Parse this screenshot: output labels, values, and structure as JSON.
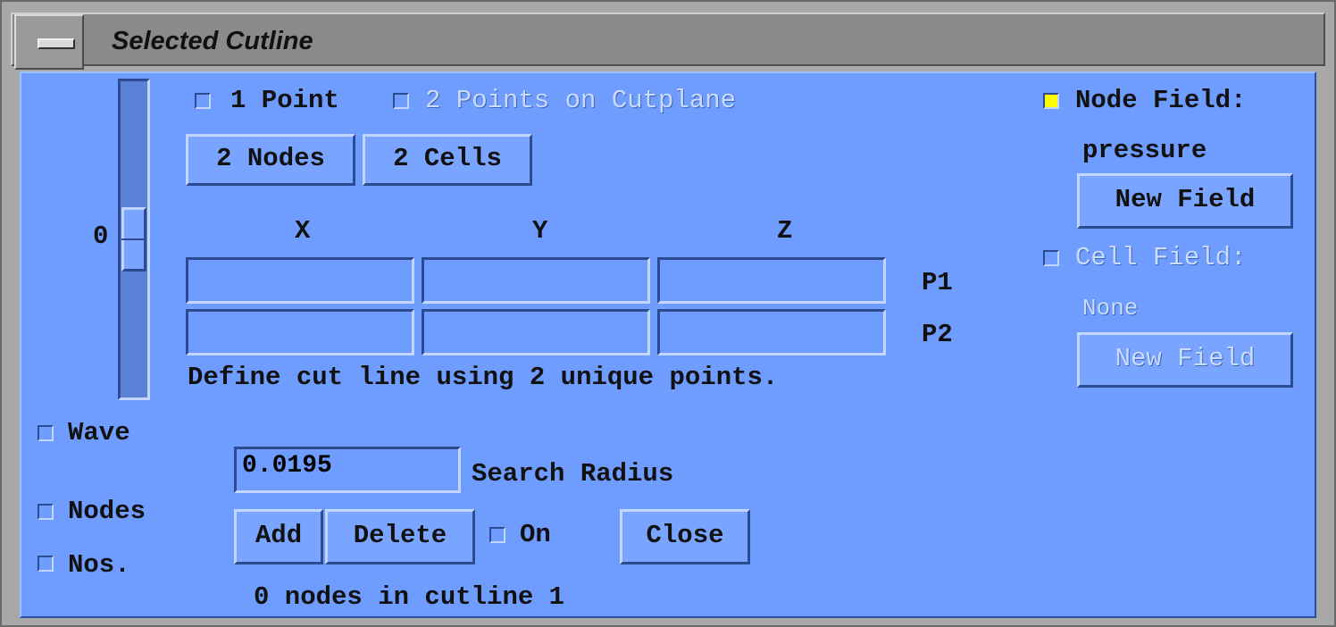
{
  "window": {
    "title": "Selected Cutline"
  },
  "mode": {
    "one_point": "1 Point",
    "two_points": "2 Points on Cutplane"
  },
  "buttons": {
    "two_nodes": "2 Nodes",
    "two_cells": "2 Cells",
    "add": "Add",
    "delete": "Delete",
    "close": "Close",
    "new_field": "New Field",
    "new_field_cell": "New Field"
  },
  "slider": {
    "value": "0"
  },
  "coords": {
    "x": "X",
    "y": "Y",
    "z": "Z",
    "p1": "P1",
    "p2": "P2",
    "p1_values": [
      "",
      "",
      ""
    ],
    "p2_values": [
      "",
      "",
      ""
    ]
  },
  "hint": "Define cut line using 2 unique points.",
  "node_field": {
    "label": "Node Field:",
    "value": "pressure",
    "checked": true
  },
  "cell_field": {
    "label": "Cell Field:",
    "value": "None",
    "checked": false
  },
  "options": {
    "wave": "Wave",
    "nodes": "Nodes",
    "nos": "Nos.",
    "on": "On"
  },
  "search": {
    "value": "0.0195",
    "label": "Search Radius"
  },
  "status": "0 nodes in cutline 1",
  "colors": {
    "panel": "#6f9cff",
    "checked": "#ffff00"
  }
}
